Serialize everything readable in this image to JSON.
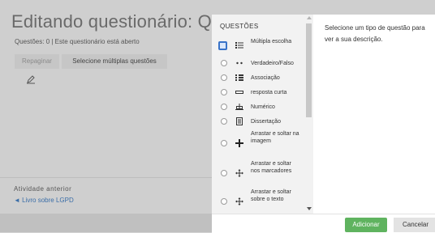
{
  "page": {
    "title": "Editando questionário: Questõ",
    "status": "Questões: 0 | Este questionário está aberto",
    "repaginate_label": "Repaginar",
    "select_multiple_label": "Selecione múltiplas questões",
    "previous_activity_label": "Atividade anterior",
    "previous_activity_link": "◄ Livro sobre LGPD"
  },
  "chooser": {
    "heading": "QUESTÕES",
    "description": "Selecione um tipo de questão para ver a sua descrição.",
    "options": [
      {
        "label": "Múltipla escolha",
        "icon": "multiple-choice-icon",
        "selected": true
      },
      {
        "label": "Verdadeiro/Falso",
        "icon": "true-false-icon",
        "selected": false
      },
      {
        "label": "Associação",
        "icon": "matching-icon",
        "selected": false
      },
      {
        "label": "resposta curta",
        "icon": "short-answer-icon",
        "selected": false
      },
      {
        "label": "Numérico",
        "icon": "numerical-icon",
        "selected": false
      },
      {
        "label": "Dissertação",
        "icon": "essay-icon",
        "selected": false
      },
      {
        "label": "Arrastar e soltar na imagem",
        "icon": "drag-drop-image-icon",
        "selected": false
      },
      {
        "label": "Arrastar e soltar nos marcadores",
        "icon": "drag-drop-markers-icon",
        "selected": false
      },
      {
        "label": "Arrastar e soltar sobre o texto",
        "icon": "drag-drop-text-icon",
        "selected": false
      }
    ],
    "add_label": "Adicionar",
    "cancel_label": "Cancelar"
  },
  "colors": {
    "add_button": "#5fb35f",
    "link": "#3b6ea8",
    "selected_radio": "#3973c8"
  }
}
